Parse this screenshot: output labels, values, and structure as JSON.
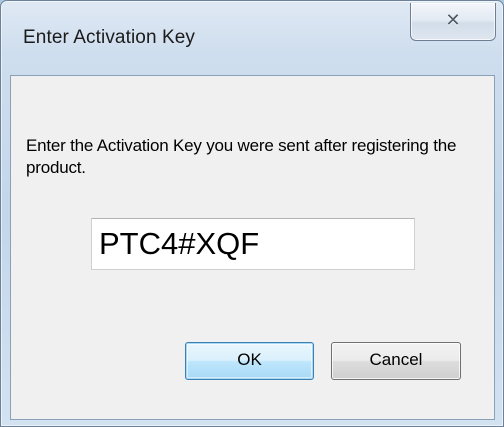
{
  "window": {
    "title": "Enter Activation Key",
    "close_icon": "close-icon"
  },
  "dialog": {
    "message": "Enter the Activation Key you were sent after registering the product.",
    "key_value": "PTC4#XQF"
  },
  "buttons": {
    "ok_label": "OK",
    "cancel_label": "Cancel"
  },
  "colors": {
    "frame": "#c3d6ea",
    "client_background": "#f0f0f0",
    "default_button_border": "#3c7fb1"
  }
}
